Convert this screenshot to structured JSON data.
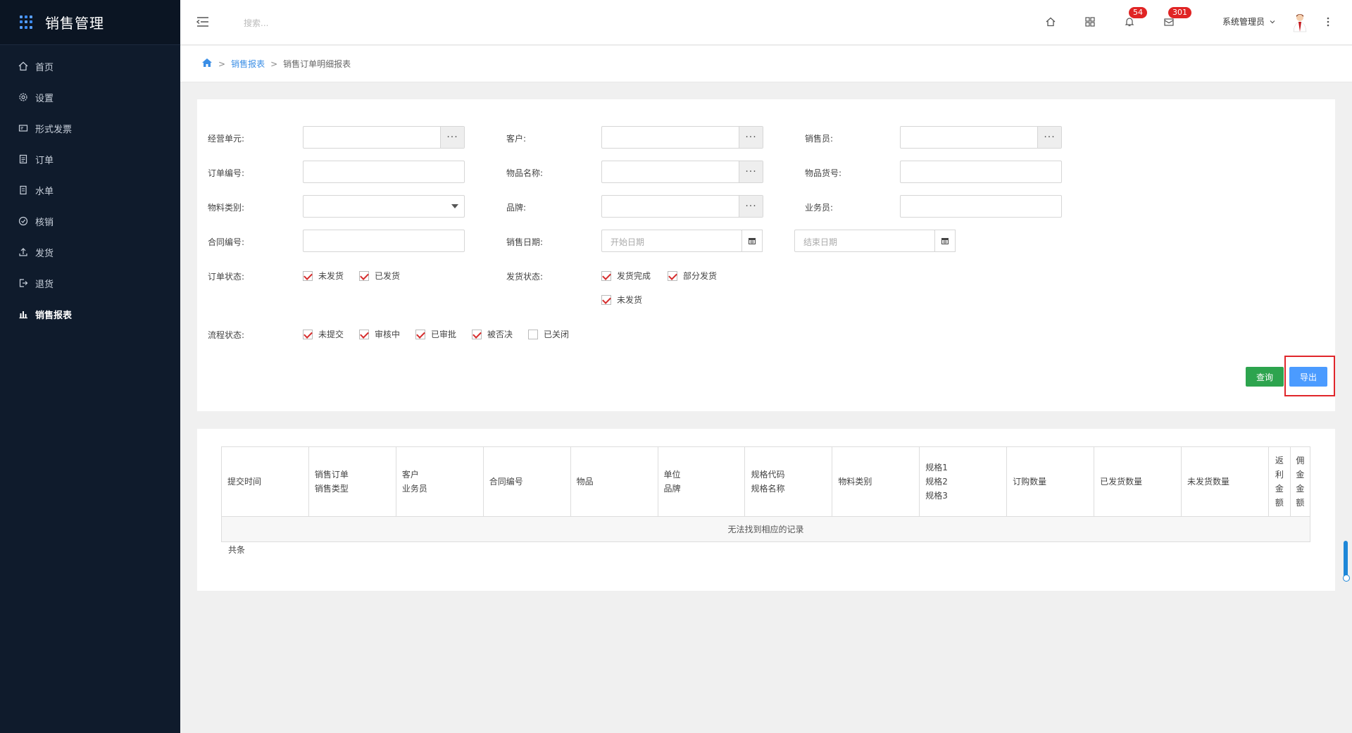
{
  "app": {
    "title": "销售管理"
  },
  "sidebar": {
    "items": [
      {
        "label": "首页",
        "icon": "home-icon"
      },
      {
        "label": "设置",
        "icon": "gear-icon"
      },
      {
        "label": "形式发票",
        "icon": "invoice-icon"
      },
      {
        "label": "订单",
        "icon": "order-icon"
      },
      {
        "label": "水单",
        "icon": "receipt-icon"
      },
      {
        "label": "核销",
        "icon": "check-circle-icon"
      },
      {
        "label": "发货",
        "icon": "upload-icon"
      },
      {
        "label": "退货",
        "icon": "return-icon"
      },
      {
        "label": "销售报表",
        "icon": "bar-chart-icon",
        "active": true
      }
    ]
  },
  "header": {
    "search_placeholder": "搜索...",
    "notifications_count": "54",
    "messages_count": "301",
    "user_name": "系统管理员"
  },
  "breadcrumb": {
    "parent": "销售报表",
    "current": "销售订单明细报表"
  },
  "filter": {
    "business_unit_label": "经营单元:",
    "customer_label": "客户:",
    "salesperson_label": "销售员:",
    "order_no_label": "订单编号:",
    "item_name_label": "物品名称:",
    "item_code_label": "物品货号:",
    "material_category_label": "物料类别:",
    "brand_label": "品牌:",
    "clerk_label": "业务员:",
    "contract_no_label": "合同编号:",
    "sale_date_label": "销售日期:",
    "start_date_placeholder": "开始日期",
    "end_date_placeholder": "结束日期",
    "order_status_label": "订单状态:",
    "order_status_options": [
      {
        "label": "未发货",
        "checked": true
      },
      {
        "label": "已发货",
        "checked": true
      }
    ],
    "ship_status_label": "发货状态:",
    "ship_status_options": [
      {
        "label": "发货完成",
        "checked": true
      },
      {
        "label": "部分发货",
        "checked": true
      },
      {
        "label": "未发货",
        "checked": true
      }
    ],
    "flow_status_label": "流程状态:",
    "flow_status_options": [
      {
        "label": "未提交",
        "checked": true
      },
      {
        "label": "审核中",
        "checked": true
      },
      {
        "label": "已审批",
        "checked": true
      },
      {
        "label": "被否决",
        "checked": true
      },
      {
        "label": "已关闭",
        "checked": false
      }
    ],
    "query_button": "查询",
    "export_button": "导出"
  },
  "table": {
    "columns": [
      "提交时间",
      "销售订单\n销售类型",
      "客户\n业务员",
      "合同编号",
      "物品",
      "单位\n品牌",
      "规格代码\n规格名称",
      "物料类别",
      "规格1\n规格2\n规格3",
      "订购数量",
      "已发货数量",
      "未发货数量",
      "返\n利\n金\n额",
      "佣\n金\n金\n额"
    ],
    "empty_text": "无法找到相应的记录",
    "total_text": "共条"
  },
  "colors": {
    "sidebar_bg": "#0f1b2c",
    "accent": "#3a8ee6",
    "query_button": "#2da44e",
    "export_button": "#4b9bff",
    "badge": "#e02424",
    "highlight_frame": "#e0262b"
  }
}
